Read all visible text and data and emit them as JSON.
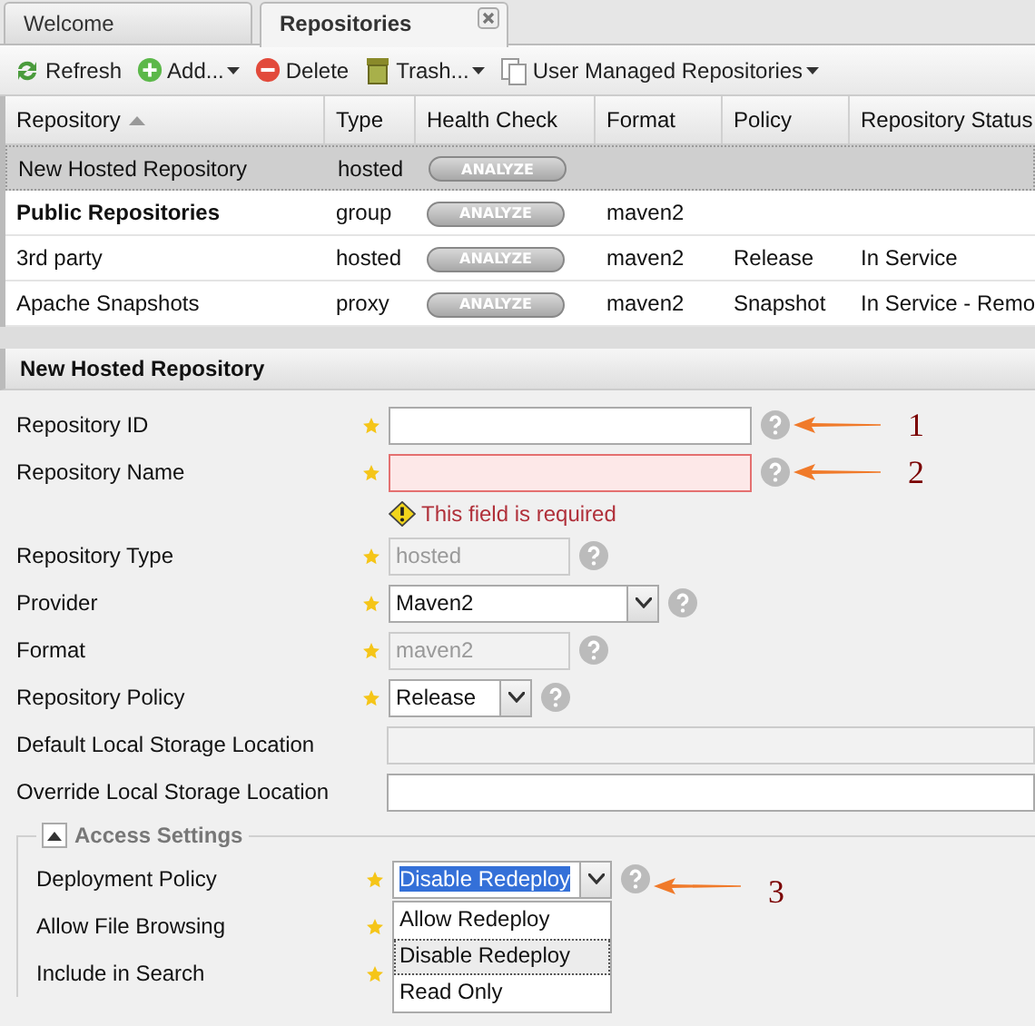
{
  "tabs": [
    {
      "label": "Welcome",
      "selected": false,
      "closable": false
    },
    {
      "label": "Repositories",
      "selected": true,
      "closable": true
    }
  ],
  "toolbar": [
    {
      "label": "Refresh",
      "kind": "refresh",
      "menu": false
    },
    {
      "label": "Add...",
      "kind": "add",
      "menu": true
    },
    {
      "label": "Delete",
      "kind": "delete",
      "menu": false
    },
    {
      "label": "Trash...",
      "kind": "trash",
      "menu": true
    },
    {
      "label": "User Managed Repositories",
      "kind": "pages",
      "menu": true
    }
  ],
  "grid": {
    "columns": [
      {
        "label": "Repository",
        "sorted": true
      },
      {
        "label": "Type",
        "sorted": false
      },
      {
        "label": "Health Check",
        "sorted": false
      },
      {
        "label": "Format",
        "sorted": false
      },
      {
        "label": "Policy",
        "sorted": false
      },
      {
        "label": "Repository Status",
        "sorted": false
      }
    ],
    "rows": [
      {
        "name": "New Hosted Repository",
        "type": "hosted",
        "health": "ANALYZE",
        "health_enabled": false,
        "selected": true,
        "bold": false
      },
      {
        "name": "Public Repositories",
        "type": "group",
        "health": "ANALYZE",
        "health_enabled": false,
        "format": "maven2",
        "selected": false,
        "bold": true
      },
      {
        "name": "3rd party",
        "type": "hosted",
        "health": "ANALYZE",
        "health_enabled": false,
        "format": "maven2",
        "policy": "Release",
        "status": "In Service",
        "selected": false,
        "bold": false
      },
      {
        "name": "Apache Snapshots",
        "type": "proxy",
        "health": "ANALYZE",
        "health_enabled": false,
        "format": "maven2",
        "policy": "Snapshot",
        "status": "In Service - Remo",
        "selected": false,
        "bold": false
      }
    ]
  },
  "form": {
    "title": "New Hosted Repository",
    "fields": [
      {
        "label": "Repository ID",
        "kind": "text",
        "required": true,
        "disabled": false,
        "invalid": false,
        "help": true,
        "annotation": "1"
      },
      {
        "label": "Repository Name",
        "kind": "text",
        "required": true,
        "disabled": false,
        "invalid": true,
        "error": "This field is required",
        "help": true,
        "annotation": "2"
      },
      {
        "label": "Repository Type",
        "kind": "text",
        "required": true,
        "disabled": true,
        "invalid": false,
        "value": "hosted",
        "help": true
      },
      {
        "label": "Provider",
        "kind": "select",
        "required": true,
        "value": "Maven2",
        "help": true
      },
      {
        "label": "Format",
        "kind": "text",
        "required": true,
        "disabled": true,
        "invalid": false,
        "value": "maven2",
        "help": true
      },
      {
        "label": "Repository Policy",
        "kind": "select",
        "required": true,
        "value": "Release",
        "help": true
      },
      {
        "label": "Default Local Storage Location",
        "kind": "text",
        "disabled": true,
        "invalid": false
      },
      {
        "label": "Override Local Storage Location",
        "kind": "text",
        "disabled": false,
        "invalid": false
      }
    ],
    "access": {
      "legend": "Access Settings",
      "expanded": true,
      "fields": [
        {
          "label": "Deployment Policy",
          "kind": "select",
          "required": true,
          "value": "Disable Redeploy",
          "highlighted": true,
          "help": true,
          "annotation": "3",
          "options": [
            {
              "label": "Allow Redeploy",
              "selected": false
            },
            {
              "label": "Disable Redeploy",
              "selected": true
            },
            {
              "label": "Read Only",
              "selected": false
            }
          ]
        },
        {
          "label": "Allow File Browsing",
          "kind": "hidden",
          "required": true
        },
        {
          "label": "Include in Search",
          "kind": "hidden",
          "required": true
        }
      ]
    }
  }
}
